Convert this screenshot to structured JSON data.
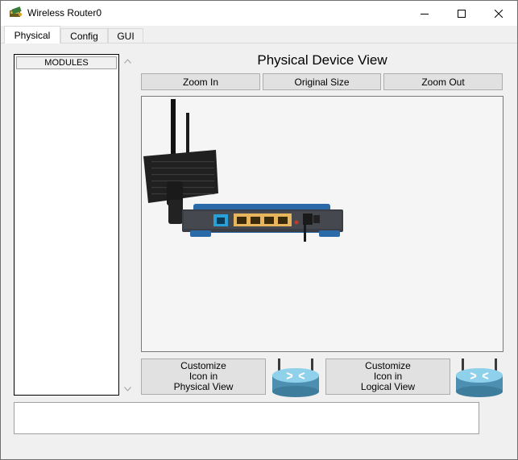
{
  "window": {
    "title": "Wireless Router0",
    "app_icon": "packet-tracer-device-icon",
    "controls": {
      "minimize": "minimize-icon",
      "maximize": "maximize-icon",
      "close": "close-icon"
    }
  },
  "tabs": [
    {
      "label": "Physical",
      "active": true
    },
    {
      "label": "Config",
      "active": false
    },
    {
      "label": "GUI",
      "active": false
    }
  ],
  "modules": {
    "header": "MODULES",
    "items": []
  },
  "physical_view": {
    "title": "Physical Device View",
    "zoom_in": "Zoom In",
    "original_size": "Original Size",
    "zoom_out": "Zoom Out",
    "device_image": "wireless-router-image"
  },
  "customize": {
    "physical": {
      "line1": "Customize",
      "line2": "Icon in",
      "line3": "Physical View"
    },
    "logical": {
      "line1": "Customize",
      "line2": "Icon in",
      "line3": "Logical View"
    },
    "icon": "router-icon"
  },
  "status": {
    "text": ""
  },
  "colors": {
    "router_icon": "#5fa8c6",
    "port_yellow": "#e7b65c",
    "port_blue": "#2aa0d9",
    "chassis_blue": "#2b6aa8"
  }
}
